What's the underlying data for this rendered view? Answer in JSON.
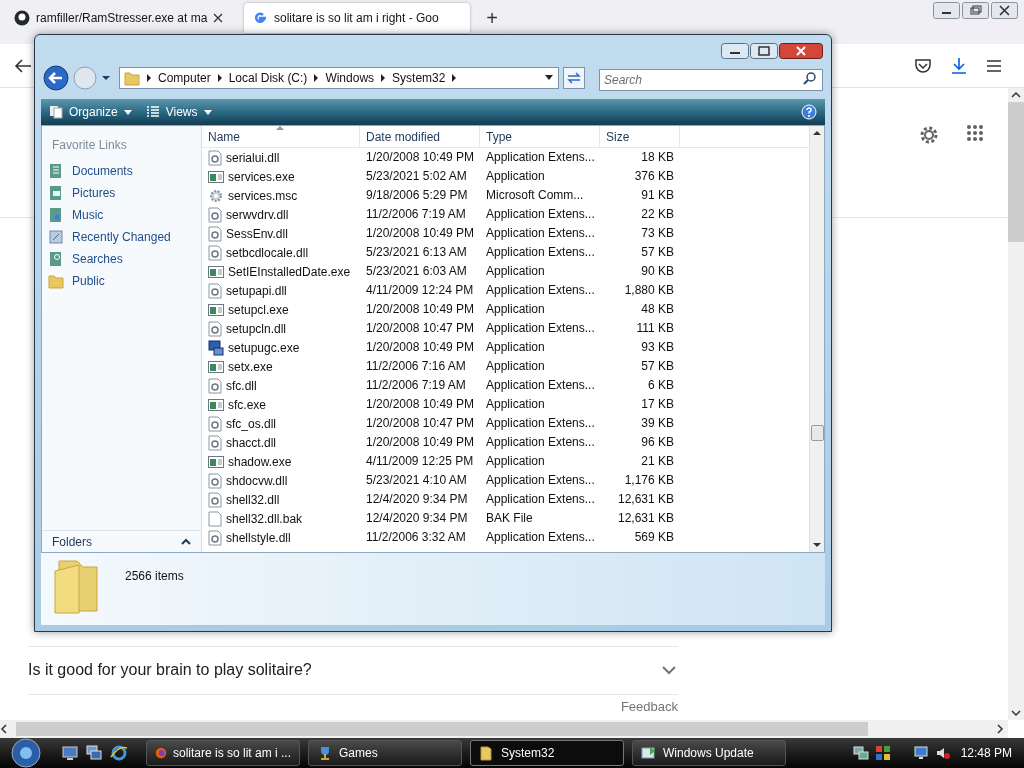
{
  "browser": {
    "tabs": [
      {
        "title": "ramfiller/RamStresser.exe at ma",
        "kind": "github",
        "selected": false
      },
      {
        "title": "solitare is so lit am i right - Goo",
        "kind": "google",
        "selected": true
      }
    ],
    "new_tab": "+"
  },
  "page": {
    "question": "Is it good for your brain to play solitaire?",
    "feedback": "Feedback"
  },
  "explorer": {
    "breadcrumb": [
      "Computer",
      "Local Disk (C:)",
      "Windows",
      "System32"
    ],
    "search": {
      "placeholder": "Search"
    },
    "toolbar": [
      "Organize",
      "Views"
    ],
    "favorites_header": "Favorite Links",
    "favorites": [
      {
        "label": "Documents",
        "kind": "documents"
      },
      {
        "label": "Pictures",
        "kind": "pictures"
      },
      {
        "label": "Music",
        "kind": "music"
      },
      {
        "label": "Recently Changed",
        "kind": "recent"
      },
      {
        "label": "Searches",
        "kind": "searches"
      },
      {
        "label": "Public",
        "kind": "folder"
      }
    ],
    "folders": "Folders",
    "columns": [
      {
        "label": "Name",
        "sorted": true
      },
      {
        "label": "Date modified",
        "sorted": false
      },
      {
        "label": "Type",
        "sorted": false
      },
      {
        "label": "Size",
        "sorted": false
      }
    ],
    "rows": [
      {
        "name": "serialui.dll",
        "date": "1/20/2008 10:49 PM",
        "type": "Application Extens...",
        "size": "18 KB",
        "kind": "dll"
      },
      {
        "name": "services.exe",
        "date": "5/23/2021 5:02 AM",
        "type": "Application",
        "size": "376 KB",
        "kind": "exe"
      },
      {
        "name": "services.msc",
        "date": "9/18/2006 5:29 PM",
        "type": "Microsoft Comm...",
        "size": "91 KB",
        "kind": "msc"
      },
      {
        "name": "serwvdrv.dll",
        "date": "11/2/2006 7:19 AM",
        "type": "Application Extens...",
        "size": "22 KB",
        "kind": "dll"
      },
      {
        "name": "SessEnv.dll",
        "date": "1/20/2008 10:49 PM",
        "type": "Application Extens...",
        "size": "73 KB",
        "kind": "dll"
      },
      {
        "name": "setbcdlocale.dll",
        "date": "5/23/2021 6:13 AM",
        "type": "Application Extens...",
        "size": "57 KB",
        "kind": "dll"
      },
      {
        "name": "SetIEInstalledDate.exe",
        "date": "5/23/2021 6:03 AM",
        "type": "Application",
        "size": "90 KB",
        "kind": "exe"
      },
      {
        "name": "setupapi.dll",
        "date": "4/11/2009 12:24 PM",
        "type": "Application Extens...",
        "size": "1,880 KB",
        "kind": "dll"
      },
      {
        "name": "setupcl.exe",
        "date": "1/20/2008 10:49 PM",
        "type": "Application",
        "size": "48 KB",
        "kind": "exe"
      },
      {
        "name": "setupcln.dll",
        "date": "1/20/2008 10:47 PM",
        "type": "Application Extens...",
        "size": "111 KB",
        "kind": "dll"
      },
      {
        "name": "setupugc.exe",
        "date": "1/20/2008 10:49 PM",
        "type": "Application",
        "size": "93 KB",
        "kind": "setup"
      },
      {
        "name": "setx.exe",
        "date": "11/2/2006 7:16 AM",
        "type": "Application",
        "size": "57 KB",
        "kind": "exe"
      },
      {
        "name": "sfc.dll",
        "date": "11/2/2006 7:19 AM",
        "type": "Application Extens...",
        "size": "6 KB",
        "kind": "dll"
      },
      {
        "name": "sfc.exe",
        "date": "1/20/2008 10:49 PM",
        "type": "Application",
        "size": "17 KB",
        "kind": "exe"
      },
      {
        "name": "sfc_os.dll",
        "date": "1/20/2008 10:47 PM",
        "type": "Application Extens...",
        "size": "39 KB",
        "kind": "dll"
      },
      {
        "name": "shacct.dll",
        "date": "1/20/2008 10:49 PM",
        "type": "Application Extens...",
        "size": "96 KB",
        "kind": "dll"
      },
      {
        "name": "shadow.exe",
        "date": "4/11/2009 12:25 PM",
        "type": "Application",
        "size": "21 KB",
        "kind": "exe"
      },
      {
        "name": "shdocvw.dll",
        "date": "5/23/2021 4:10 AM",
        "type": "Application Extens...",
        "size": "1,176 KB",
        "kind": "dll"
      },
      {
        "name": "shell32.dll",
        "date": "12/4/2020 9:34 PM",
        "type": "Application Extens...",
        "size": "12,631 KB",
        "kind": "dll"
      },
      {
        "name": "shell32.dll.bak",
        "date": "12/4/2020 9:34 PM",
        "type": "BAK File",
        "size": "12,631 KB",
        "kind": "file"
      },
      {
        "name": "shellstyle.dll",
        "date": "11/2/2006 3:32 AM",
        "type": "Application Extens...",
        "size": "569 KB",
        "kind": "dll"
      }
    ],
    "status": "2566 items"
  },
  "taskbar": {
    "buttons": [
      {
        "label": "solitare is so lit am i ...",
        "kind": "firefox",
        "selected": false
      },
      {
        "label": "Games",
        "kind": "games",
        "selected": false
      },
      {
        "label": "System32",
        "kind": "folder",
        "selected": true
      },
      {
        "label": "Windows Update",
        "kind": "update",
        "selected": false
      }
    ],
    "clock": "12:48 PM"
  }
}
